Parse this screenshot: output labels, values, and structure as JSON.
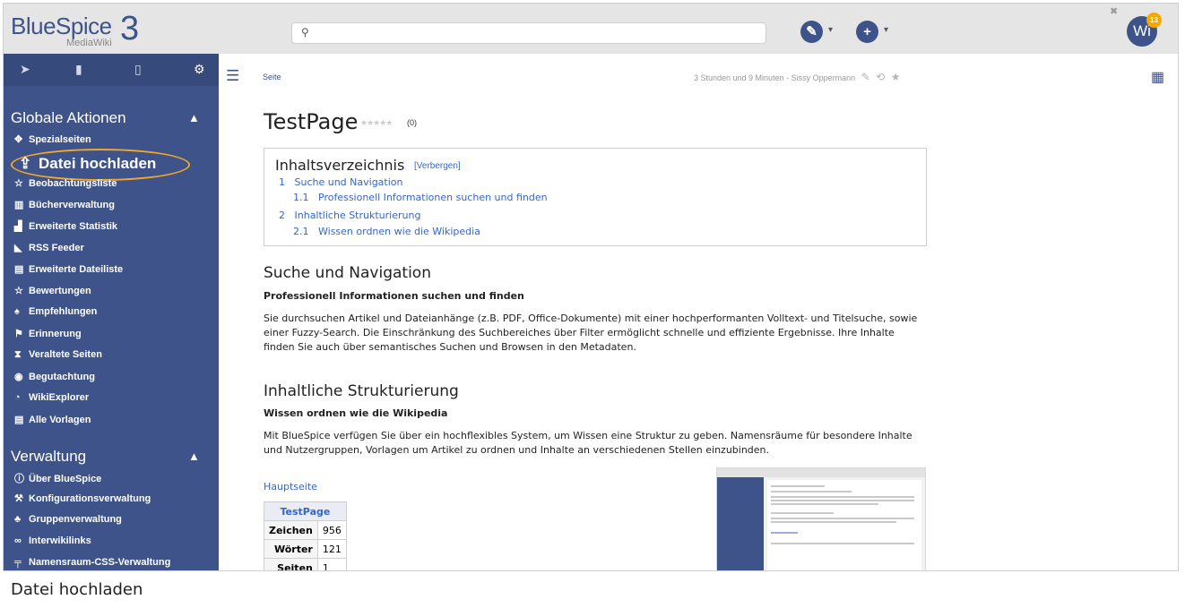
{
  "logo": {
    "text": "BlueSpice",
    "sub": "MediaWiki",
    "version": "3"
  },
  "header": {
    "user_initials": "Wi",
    "notifications": "13"
  },
  "sidebar": {
    "sections": [
      {
        "title": "Globale Aktionen",
        "items": [
          {
            "icon": "puzzle-icon",
            "glyph": "✥",
            "label": "Spezialseiten"
          },
          {
            "icon": "upload-icon",
            "glyph": "⇪",
            "label": "Datei hochladen",
            "highlighted": true
          },
          {
            "icon": "star-icon",
            "glyph": "☆",
            "label": "Beobachtungsliste"
          },
          {
            "icon": "books-icon",
            "glyph": "▥",
            "label": "Bücherverwaltung"
          },
          {
            "icon": "chart-icon",
            "glyph": "▟",
            "label": "Erweiterte Statistik"
          },
          {
            "icon": "rss-icon",
            "glyph": "◣",
            "label": "RSS Feeder"
          },
          {
            "icon": "filelist-icon",
            "glyph": "▤",
            "label": "Erweiterte Dateiliste"
          },
          {
            "icon": "star-icon",
            "glyph": "☆",
            "label": "Bewertungen"
          },
          {
            "icon": "fire-icon",
            "glyph": "♠",
            "label": "Empfehlungen"
          },
          {
            "icon": "flag-icon",
            "glyph": "⚑",
            "label": "Erinnerung"
          },
          {
            "icon": "hourglass-icon",
            "glyph": "⧗",
            "label": "Veraltete Seiten"
          },
          {
            "icon": "eye-icon",
            "glyph": "◉",
            "label": "Begutachtung"
          },
          {
            "icon": "compass-icon",
            "glyph": "◔",
            "label": "WikiExplorer"
          },
          {
            "icon": "template-icon",
            "glyph": "▤",
            "label": "Alle Vorlagen"
          }
        ]
      },
      {
        "title": "Verwaltung",
        "items": [
          {
            "icon": "info-icon",
            "glyph": "ⓘ",
            "label": "Über BlueSpice"
          },
          {
            "icon": "wrench-icon",
            "glyph": "⚒",
            "label": "Konfigurationsverwaltung"
          },
          {
            "icon": "group-icon",
            "glyph": "♣",
            "label": "Gruppenverwaltung"
          },
          {
            "icon": "link-icon",
            "glyph": "∞",
            "label": "Interwikilinks"
          },
          {
            "icon": "paint-icon",
            "glyph": "╤",
            "label": "Namensraum-CSS-Verwaltung"
          }
        ]
      }
    ]
  },
  "main": {
    "breadcrumb": "Seite",
    "meta": "3 Stunden und 9 Minuten - Sissy Oppermann",
    "title": "TestPage",
    "rating_count": "(0)",
    "toc": {
      "title": "Inhaltsverzeichnis",
      "toggle": "[Verbergen]",
      "entries": [
        {
          "num": "1",
          "text": "Suche und Navigation"
        },
        {
          "num": "1.1",
          "text": "Professionell Informationen suchen und finden"
        },
        {
          "num": "2",
          "text": "Inhaltliche Strukturierung"
        },
        {
          "num": "2.1",
          "text": "Wissen ordnen wie die Wikipedia"
        }
      ]
    },
    "sections": [
      {
        "heading": "Suche und Navigation",
        "subheading": "Professionell Informationen suchen und finden",
        "text": "Sie durchsuchen Artikel und Dateianhänge (z.B. PDF, Office-Dokumente) mit einer hochperformanten Volltext- und Titelsuche, sowie einer Fuzzy-Search. Die Einschränkung des Suchbereiches über Filter ermöglicht schnelle und effiziente Ergebnisse. Ihre Inhalte finden Sie auch über semantisches Suchen und Browsen in den Metadaten."
      },
      {
        "heading": "Inhaltliche Strukturierung",
        "subheading": "Wissen ordnen wie die Wikipedia",
        "text": "Mit BlueSpice verfügen Sie über ein hochflexibles System, um Wissen eine Struktur zu geben. Namensräume für besondere Inhalte und Nutzergruppen, Vorlagen um Artikel zu ordnen und Inhalte an verschiedenen Stellen einzubinden."
      }
    ],
    "main_link": "Hauptseite",
    "stats": {
      "header": "TestPage",
      "rows": [
        {
          "label": "Zeichen",
          "value": "956"
        },
        {
          "label": "Wörter",
          "value": "121"
        },
        {
          "label": "Seiten",
          "value": "1"
        }
      ]
    }
  },
  "caption": "Datei hochladen"
}
